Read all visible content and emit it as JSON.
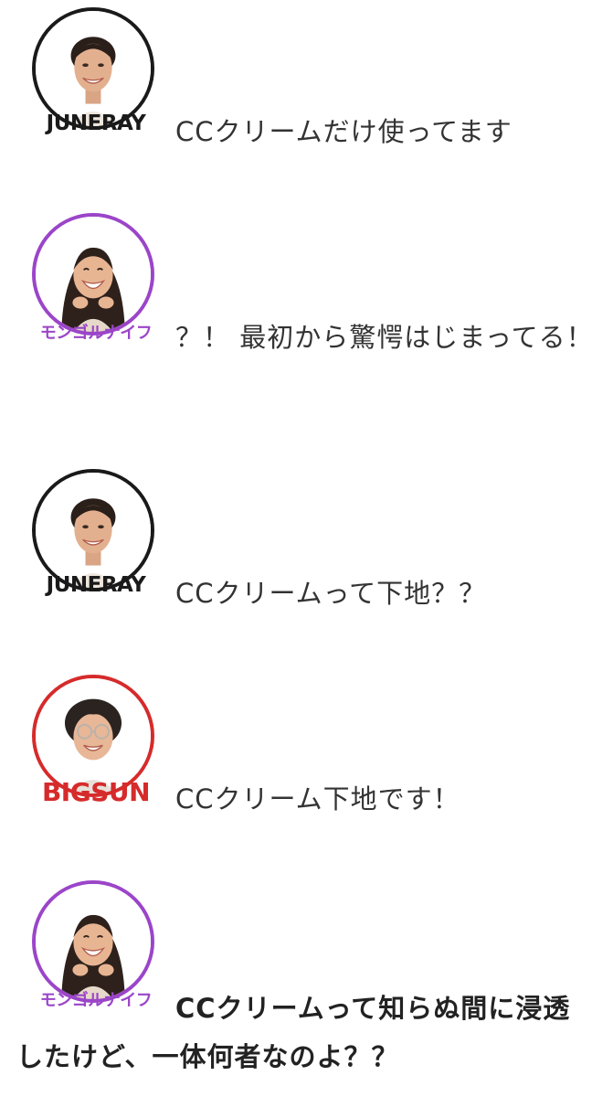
{
  "colors": {
    "juneray": "#1a1a1a",
    "mongol_knife": "#9b45c9",
    "bigsun": "#d62b2b",
    "text": "#333333"
  },
  "messages": [
    {
      "speaker": "JUNERAY",
      "icon": "juneray-avatar-icon",
      "text": "CCクリームだけ使ってます"
    },
    {
      "speaker": "モンゴルナイフ",
      "icon": "mongol-knife-avatar-icon",
      "text": "？！ 最初から驚愕はじまってる！"
    },
    {
      "speaker": "JUNERAY",
      "icon": "juneray-avatar-icon",
      "text": "CCクリームって下地？？"
    },
    {
      "speaker": "BIGSUN",
      "icon": "bigsun-avatar-icon",
      "text": "CCクリーム下地です！"
    },
    {
      "speaker": "モンゴルナイフ",
      "icon": "mongol-knife-avatar-icon",
      "text": "CCクリームって知らぬ間に浸透したけど、一体何者なのよ？？"
    }
  ]
}
